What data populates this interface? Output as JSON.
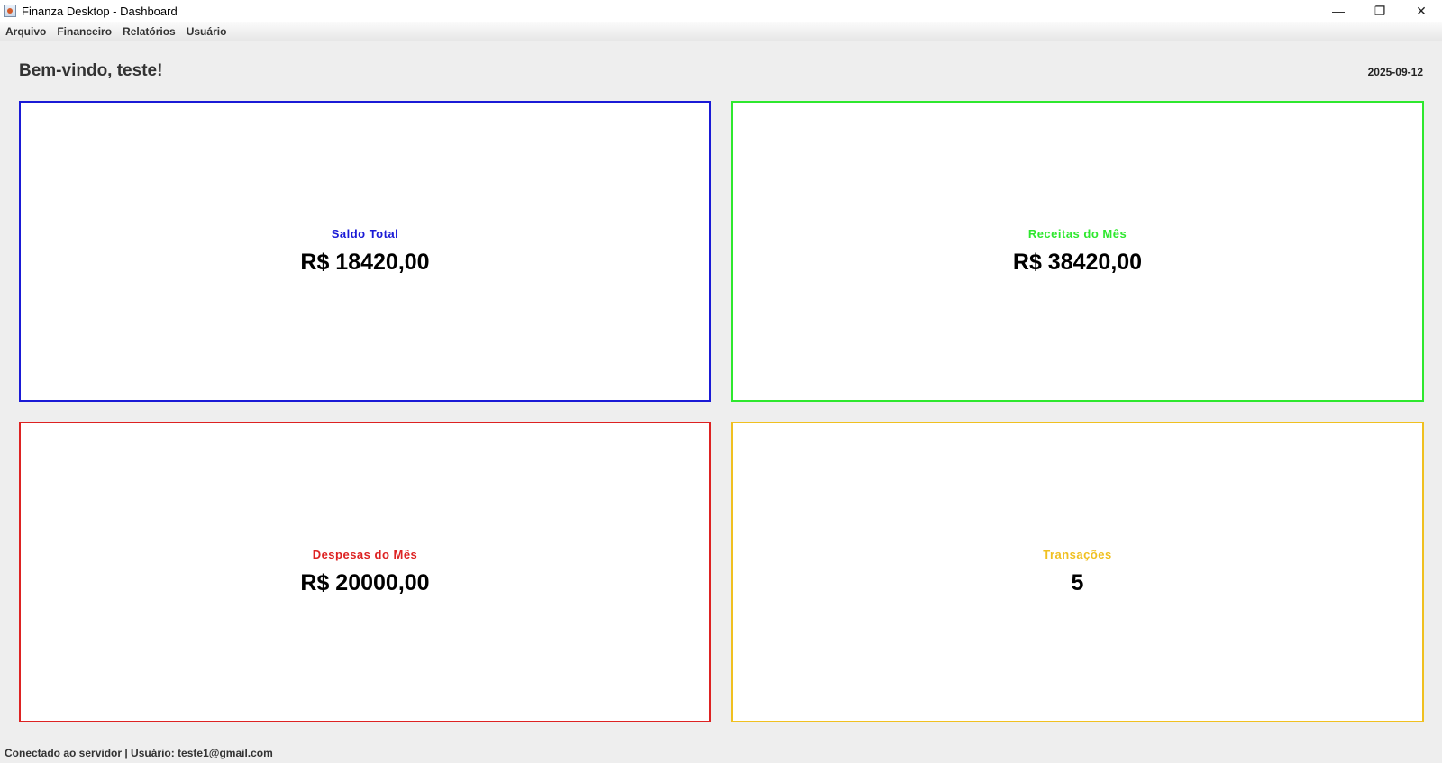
{
  "window": {
    "title": "Finanza Desktop - Dashboard",
    "minimize_glyph": "—",
    "restore_glyph": "❐",
    "close_glyph": "✕"
  },
  "menu": {
    "items": [
      "Arquivo",
      "Financeiro",
      "Relatórios",
      "Usuário"
    ]
  },
  "header": {
    "welcome": "Bem-vindo, teste!",
    "date": "2025-09-12"
  },
  "cards": [
    {
      "title": "Saldo Total",
      "value": "R$ 18420,00",
      "color": "#1a1ad6"
    },
    {
      "title": "Receitas do Mês",
      "value": "R$ 38420,00",
      "color": "#2ee82e"
    },
    {
      "title": "Despesas do Mês",
      "value": "R$ 20000,00",
      "color": "#dd2222"
    },
    {
      "title": "Transações",
      "value": "5",
      "color": "#f0c020"
    }
  ],
  "status": {
    "text": "Conectado ao servidor | Usuário: teste1@gmail.com"
  }
}
